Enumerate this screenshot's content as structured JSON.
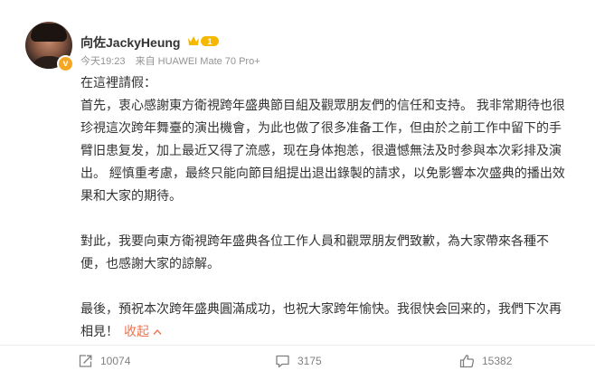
{
  "post": {
    "author": "向佐JackyHeung",
    "level_badge": "1",
    "verified_badge": "v",
    "time": "今天19:23",
    "source": "来自 HUAWEI Mate 70 Pro+",
    "paragraphs": [
      "在這裡請假：",
      "首先，衷心感謝東方衛視跨年盛典節目組及觀眾朋友們的信任和支持。 我非常期待也很珍視這次跨年舞臺的演出機會，为此也做了很多准备工作，但由於之前工作中留下的手臂旧患复发，加上最近又得了流感，现在身体抱恙，很遺憾無法及时参與本次彩排及演出。 經慎重考慮，最終只能向節目組提出退出錄製的請求，以免影響本次盛典的播出效果和大家的期待。",
      "對此，我要向東方衛視跨年盛典各位工作人員和觀眾朋友們致歉，為大家帶來各種不便，也感謝大家的諒解。",
      "最後，預祝本次跨年盛典圓滿成功，也祝大家跨年愉快。我很快会回来的，我們下次再相見！"
    ],
    "collapse_label": "收起",
    "collapse_icon": "chevron-up-icon"
  },
  "actions": {
    "repost_count": "10074",
    "comment_count": "3175",
    "like_count": "15382"
  },
  "colors": {
    "accent": "#eb7350",
    "text": "#333333",
    "meta": "#939393",
    "level_badge": "#f5b800"
  }
}
